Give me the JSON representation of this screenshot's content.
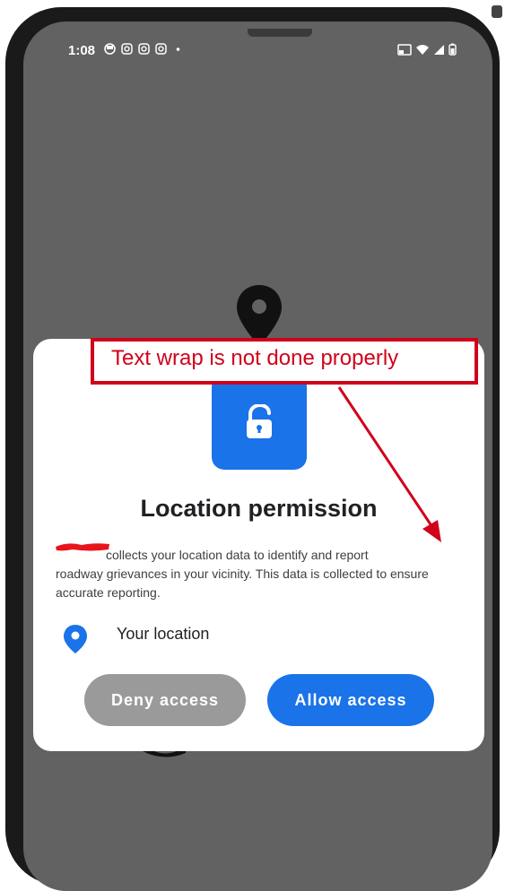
{
  "status_bar": {
    "time": "1:08",
    "left_icons": [
      "sync-icon",
      "instagram-icon",
      "instagram-icon",
      "instagram-icon",
      "dot-icon"
    ],
    "right_icons": [
      "cast-icon",
      "wifi-icon",
      "signal-icon",
      "battery-icon"
    ]
  },
  "dialog": {
    "title": "Location permission",
    "body_first_line": "collects your location data to identify and report",
    "body_rest": "roadway grievances in your vicinity. This data is collected to ensure accurate reporting.",
    "location_label": "Your location",
    "deny_label": "Deny access",
    "allow_label": "Allow access"
  },
  "annotation": {
    "text": "Text wrap is not done properly"
  },
  "colors": {
    "accent": "#1a73e8",
    "deny": "#9a9a9a",
    "annotation": "#d0021b",
    "backdrop": "#626262"
  }
}
